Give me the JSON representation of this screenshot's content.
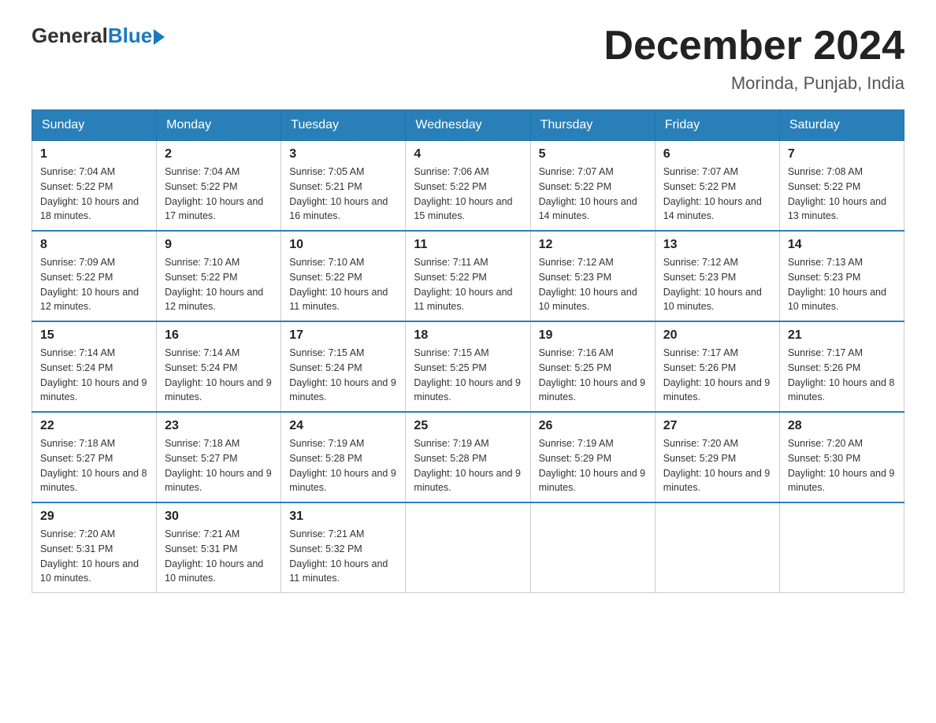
{
  "header": {
    "logo_general": "General",
    "logo_blue": "Blue",
    "month_title": "December 2024",
    "location": "Morinda, Punjab, India"
  },
  "days_of_week": [
    "Sunday",
    "Monday",
    "Tuesday",
    "Wednesday",
    "Thursday",
    "Friday",
    "Saturday"
  ],
  "weeks": [
    [
      {
        "day": "1",
        "sunrise": "7:04 AM",
        "sunset": "5:22 PM",
        "daylight": "10 hours and 18 minutes."
      },
      {
        "day": "2",
        "sunrise": "7:04 AM",
        "sunset": "5:22 PM",
        "daylight": "10 hours and 17 minutes."
      },
      {
        "day": "3",
        "sunrise": "7:05 AM",
        "sunset": "5:21 PM",
        "daylight": "10 hours and 16 minutes."
      },
      {
        "day": "4",
        "sunrise": "7:06 AM",
        "sunset": "5:22 PM",
        "daylight": "10 hours and 15 minutes."
      },
      {
        "day": "5",
        "sunrise": "7:07 AM",
        "sunset": "5:22 PM",
        "daylight": "10 hours and 14 minutes."
      },
      {
        "day": "6",
        "sunrise": "7:07 AM",
        "sunset": "5:22 PM",
        "daylight": "10 hours and 14 minutes."
      },
      {
        "day": "7",
        "sunrise": "7:08 AM",
        "sunset": "5:22 PM",
        "daylight": "10 hours and 13 minutes."
      }
    ],
    [
      {
        "day": "8",
        "sunrise": "7:09 AM",
        "sunset": "5:22 PM",
        "daylight": "10 hours and 12 minutes."
      },
      {
        "day": "9",
        "sunrise": "7:10 AM",
        "sunset": "5:22 PM",
        "daylight": "10 hours and 12 minutes."
      },
      {
        "day": "10",
        "sunrise": "7:10 AM",
        "sunset": "5:22 PM",
        "daylight": "10 hours and 11 minutes."
      },
      {
        "day": "11",
        "sunrise": "7:11 AM",
        "sunset": "5:22 PM",
        "daylight": "10 hours and 11 minutes."
      },
      {
        "day": "12",
        "sunrise": "7:12 AM",
        "sunset": "5:23 PM",
        "daylight": "10 hours and 10 minutes."
      },
      {
        "day": "13",
        "sunrise": "7:12 AM",
        "sunset": "5:23 PM",
        "daylight": "10 hours and 10 minutes."
      },
      {
        "day": "14",
        "sunrise": "7:13 AM",
        "sunset": "5:23 PM",
        "daylight": "10 hours and 10 minutes."
      }
    ],
    [
      {
        "day": "15",
        "sunrise": "7:14 AM",
        "sunset": "5:24 PM",
        "daylight": "10 hours and 9 minutes."
      },
      {
        "day": "16",
        "sunrise": "7:14 AM",
        "sunset": "5:24 PM",
        "daylight": "10 hours and 9 minutes."
      },
      {
        "day": "17",
        "sunrise": "7:15 AM",
        "sunset": "5:24 PM",
        "daylight": "10 hours and 9 minutes."
      },
      {
        "day": "18",
        "sunrise": "7:15 AM",
        "sunset": "5:25 PM",
        "daylight": "10 hours and 9 minutes."
      },
      {
        "day": "19",
        "sunrise": "7:16 AM",
        "sunset": "5:25 PM",
        "daylight": "10 hours and 9 minutes."
      },
      {
        "day": "20",
        "sunrise": "7:17 AM",
        "sunset": "5:26 PM",
        "daylight": "10 hours and 9 minutes."
      },
      {
        "day": "21",
        "sunrise": "7:17 AM",
        "sunset": "5:26 PM",
        "daylight": "10 hours and 8 minutes."
      }
    ],
    [
      {
        "day": "22",
        "sunrise": "7:18 AM",
        "sunset": "5:27 PM",
        "daylight": "10 hours and 8 minutes."
      },
      {
        "day": "23",
        "sunrise": "7:18 AM",
        "sunset": "5:27 PM",
        "daylight": "10 hours and 9 minutes."
      },
      {
        "day": "24",
        "sunrise": "7:19 AM",
        "sunset": "5:28 PM",
        "daylight": "10 hours and 9 minutes."
      },
      {
        "day": "25",
        "sunrise": "7:19 AM",
        "sunset": "5:28 PM",
        "daylight": "10 hours and 9 minutes."
      },
      {
        "day": "26",
        "sunrise": "7:19 AM",
        "sunset": "5:29 PM",
        "daylight": "10 hours and 9 minutes."
      },
      {
        "day": "27",
        "sunrise": "7:20 AM",
        "sunset": "5:29 PM",
        "daylight": "10 hours and 9 minutes."
      },
      {
        "day": "28",
        "sunrise": "7:20 AM",
        "sunset": "5:30 PM",
        "daylight": "10 hours and 9 minutes."
      }
    ],
    [
      {
        "day": "29",
        "sunrise": "7:20 AM",
        "sunset": "5:31 PM",
        "daylight": "10 hours and 10 minutes."
      },
      {
        "day": "30",
        "sunrise": "7:21 AM",
        "sunset": "5:31 PM",
        "daylight": "10 hours and 10 minutes."
      },
      {
        "day": "31",
        "sunrise": "7:21 AM",
        "sunset": "5:32 PM",
        "daylight": "10 hours and 11 minutes."
      },
      null,
      null,
      null,
      null
    ]
  ]
}
